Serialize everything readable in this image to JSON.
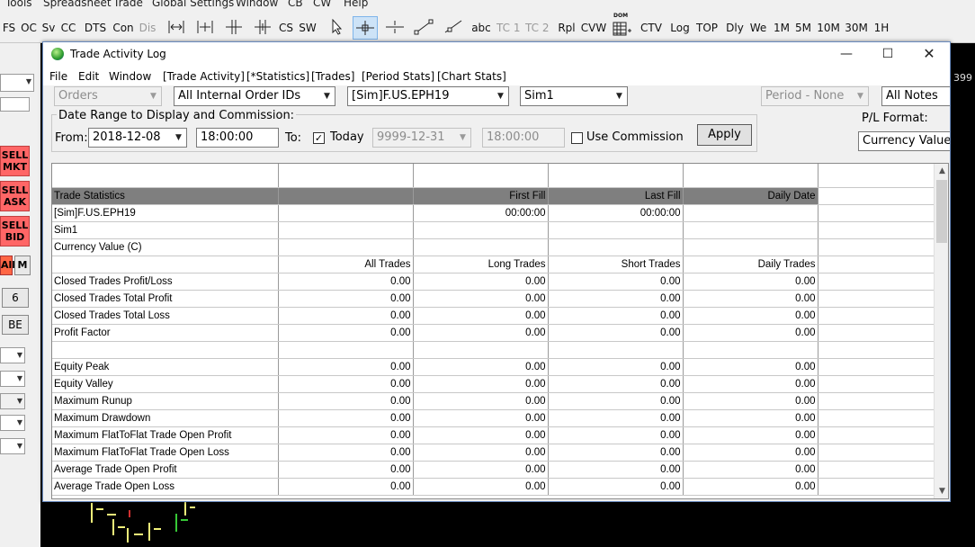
{
  "app_menu": {
    "items": [
      "Tools",
      "Spreadsheet",
      "Trade",
      "Global Settings",
      "Window",
      "CB",
      "CW",
      "Help"
    ]
  },
  "toolbar": {
    "buttons": [
      "FS",
      "OC",
      "Sv",
      "CC",
      "DTS",
      "Con",
      "Dis",
      "CS",
      "SW",
      "abc",
      "TC 1",
      "TC 2",
      "Rpl",
      "CVW",
      "CTV",
      "Log",
      "TOP",
      "Dly",
      "We",
      "1M",
      "5M",
      "10M",
      "30M",
      "1H"
    ],
    "icons": [
      "expand-horizontal-icon",
      "compress-horizontal-icon",
      "split-vertical-icon",
      "merge-vertical-icon",
      "pointer-icon",
      "crosshair-icon",
      "horizontal-cursor-icon",
      "line-tool-icon",
      "ray-tool-icon",
      "grid-dom-icon"
    ],
    "grid_icon_label": "DOM"
  },
  "left_panel": {
    "sell_mkt": [
      "SELL",
      "MKT"
    ],
    "sell_ask": [
      "SELL",
      "ASK"
    ],
    "sell_bid": [
      "SELL",
      "BID"
    ],
    "all": "All",
    "m": "M",
    "six": "6",
    "be": "BE"
  },
  "right_edge": {
    "partial_value": "399"
  },
  "window": {
    "title": "Trade Activity Log",
    "icon": "globe-icon",
    "controls": [
      "minimize-icon",
      "maximize-icon",
      "close-icon"
    ],
    "menu": [
      "File",
      "Edit",
      "Window",
      "[Trade Activity]",
      "[*Statistics]",
      "[Trades]",
      "[Period Stats]",
      "[Chart Stats]"
    ]
  },
  "filters": {
    "type": "Orders",
    "order_ids": "All Internal Order IDs",
    "symbol": "[Sim]F.US.EPH19",
    "account": "Sim1",
    "period": "Period - None",
    "notes": "All Notes",
    "pl_format_label": "P/L Format:",
    "pl_format": "Currency Value ("
  },
  "date_range": {
    "title": "Date Range to Display and Commission:",
    "from_label": "From:",
    "from_date": "2018-12-08",
    "from_time": "18:00:00",
    "to_label": "To:",
    "today_label": "Today",
    "today_checked": "✓",
    "to_date": "9999-12-31",
    "to_time": "18:00:00",
    "use_commission_label": "Use Commission",
    "apply_label": "Apply"
  },
  "grid": {
    "header": [
      "Trade Statistics",
      "",
      "First Fill",
      "Last Fill",
      "Daily Date"
    ],
    "info_rows": [
      [
        "[Sim]F.US.EPH19",
        "",
        "00:00:00",
        "00:00:00",
        ""
      ],
      [
        "Sim1",
        "",
        "",
        "",
        ""
      ],
      [
        "Currency Value (C)",
        "",
        "",
        "",
        ""
      ]
    ],
    "columns": [
      "",
      "All Trades",
      "Long Trades",
      "Short Trades",
      "Daily Trades"
    ],
    "stats_a": [
      [
        "Closed Trades Profit/Loss",
        "0.00",
        "0.00",
        "0.00",
        "0.00"
      ],
      [
        "Closed Trades Total Profit",
        "0.00",
        "0.00",
        "0.00",
        "0.00"
      ],
      [
        "Closed Trades Total Loss",
        "0.00",
        "0.00",
        "0.00",
        "0.00"
      ],
      [
        "Profit Factor",
        "0.00",
        "0.00",
        "0.00",
        "0.00"
      ]
    ],
    "stats_b": [
      [
        "Equity Peak",
        "0.00",
        "0.00",
        "0.00",
        "0.00"
      ],
      [
        "Equity Valley",
        "0.00",
        "0.00",
        "0.00",
        "0.00"
      ],
      [
        "Maximum Runup",
        "0.00",
        "0.00",
        "0.00",
        "0.00"
      ],
      [
        "Maximum Drawdown",
        "0.00",
        "0.00",
        "0.00",
        "0.00"
      ],
      [
        "Maximum FlatToFlat Trade Open Profit",
        "0.00",
        "0.00",
        "0.00",
        "0.00"
      ],
      [
        "Maximum FlatToFlat Trade Open Loss",
        "0.00",
        "0.00",
        "0.00",
        "0.00"
      ],
      [
        "Average Trade Open Profit",
        "0.00",
        "0.00",
        "0.00",
        "0.00"
      ],
      [
        "Average Trade Open Loss",
        "0.00",
        "0.00",
        "0.00",
        "0.00"
      ]
    ]
  },
  "colors": {
    "sell_button": "#ff6666",
    "grid_header": "#7f7f7f",
    "window_border": "#6a8bbf"
  }
}
